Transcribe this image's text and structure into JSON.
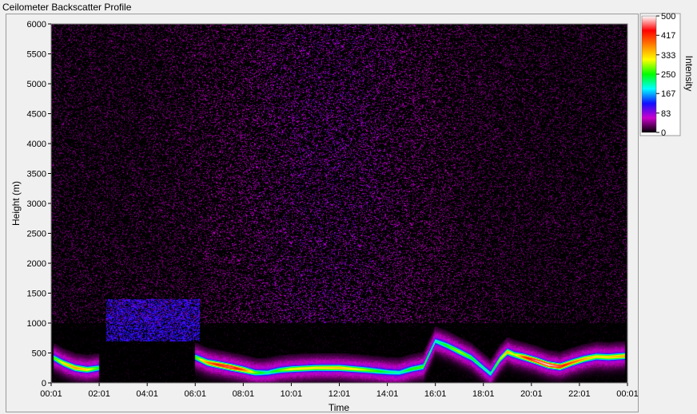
{
  "chart_data": {
    "type": "heatmap",
    "title": "Ceilometer Backscatter Profile",
    "xlabel": "Time",
    "ylabel": "Height (m)",
    "x_ticks": [
      "00:01",
      "02:01",
      "04:01",
      "06:01",
      "08:01",
      "10:01",
      "12:01",
      "14:01",
      "16:01",
      "18:01",
      "20:01",
      "22:01",
      "00:01"
    ],
    "xlim_hours": [
      0,
      24
    ],
    "y_ticks": [
      0,
      500,
      1000,
      1500,
      2000,
      2500,
      3000,
      3500,
      4000,
      4500,
      5000,
      5500,
      6000
    ],
    "ylim": [
      0,
      6000
    ],
    "colorbar": {
      "label": "Intensity",
      "ticks": [
        0,
        83,
        167,
        250,
        333,
        417,
        500
      ],
      "range": [
        0,
        500
      ],
      "colors": [
        "#000000",
        "#cc00cc",
        "#1010ff",
        "#00ffff",
        "#00ff00",
        "#ffff00",
        "#ff8000",
        "#ff0000",
        "#ffffff"
      ]
    },
    "features": {
      "boundary_layer": [
        {
          "hour": 0.1,
          "height": 420,
          "intensity": 260
        },
        {
          "hour": 0.5,
          "height": 330,
          "intensity": 330
        },
        {
          "hour": 1.0,
          "height": 250,
          "intensity": 370
        },
        {
          "hour": 1.5,
          "height": 220,
          "intensity": 330
        },
        {
          "hour": 2.0,
          "height": 250,
          "intensity": 250
        },
        {
          "hour": 6.0,
          "height": 430,
          "intensity": 260
        },
        {
          "hour": 6.5,
          "height": 340,
          "intensity": 380
        },
        {
          "hour": 7.0,
          "height": 300,
          "intensity": 450
        },
        {
          "hour": 7.5,
          "height": 260,
          "intensity": 470
        },
        {
          "hour": 8.0,
          "height": 220,
          "intensity": 400
        },
        {
          "hour": 8.5,
          "height": 170,
          "intensity": 280
        },
        {
          "hour": 9.0,
          "height": 170,
          "intensity": 220
        },
        {
          "hour": 9.5,
          "height": 210,
          "intensity": 270
        },
        {
          "hour": 10.0,
          "height": 230,
          "intensity": 320
        },
        {
          "hour": 11.0,
          "height": 250,
          "intensity": 330
        },
        {
          "hour": 12.0,
          "height": 250,
          "intensity": 350
        },
        {
          "hour": 13.0,
          "height": 220,
          "intensity": 300
        },
        {
          "hour": 14.0,
          "height": 180,
          "intensity": 230
        },
        {
          "hour": 14.5,
          "height": 170,
          "intensity": 210
        },
        {
          "hour": 15.0,
          "height": 230,
          "intensity": 260
        },
        {
          "hour": 15.5,
          "height": 270,
          "intensity": 270
        },
        {
          "hour": 16.0,
          "height": 700,
          "intensity": 210
        },
        {
          "hour": 16.5,
          "height": 620,
          "intensity": 260
        },
        {
          "hour": 17.0,
          "height": 520,
          "intensity": 300
        },
        {
          "hour": 17.5,
          "height": 420,
          "intensity": 260
        },
        {
          "hour": 18.0,
          "height": 250,
          "intensity": 220
        },
        {
          "hour": 18.3,
          "height": 150,
          "intensity": 220
        },
        {
          "hour": 18.7,
          "height": 400,
          "intensity": 300
        },
        {
          "hour": 19.0,
          "height": 520,
          "intensity": 360
        },
        {
          "hour": 19.3,
          "height": 470,
          "intensity": 300
        },
        {
          "hour": 19.7,
          "height": 430,
          "intensity": 420
        },
        {
          "hour": 20.2,
          "height": 370,
          "intensity": 480
        },
        {
          "hour": 20.7,
          "height": 300,
          "intensity": 500
        },
        {
          "hour": 21.2,
          "height": 270,
          "intensity": 460
        },
        {
          "hour": 21.7,
          "height": 340,
          "intensity": 400
        },
        {
          "hour": 22.2,
          "height": 400,
          "intensity": 360
        },
        {
          "hour": 22.7,
          "height": 440,
          "intensity": 330
        },
        {
          "hour": 23.2,
          "height": 430,
          "intensity": 340
        },
        {
          "hour": 23.9,
          "height": 450,
          "intensity": 360
        }
      ],
      "aerosol_layers": [
        {
          "hour_start": 2.3,
          "hour_end": 6.2,
          "height_low": 700,
          "height_high": 1400,
          "intensity": 130
        }
      ],
      "noise_band_height": [
        1000,
        6000
      ],
      "grid": false
    }
  }
}
